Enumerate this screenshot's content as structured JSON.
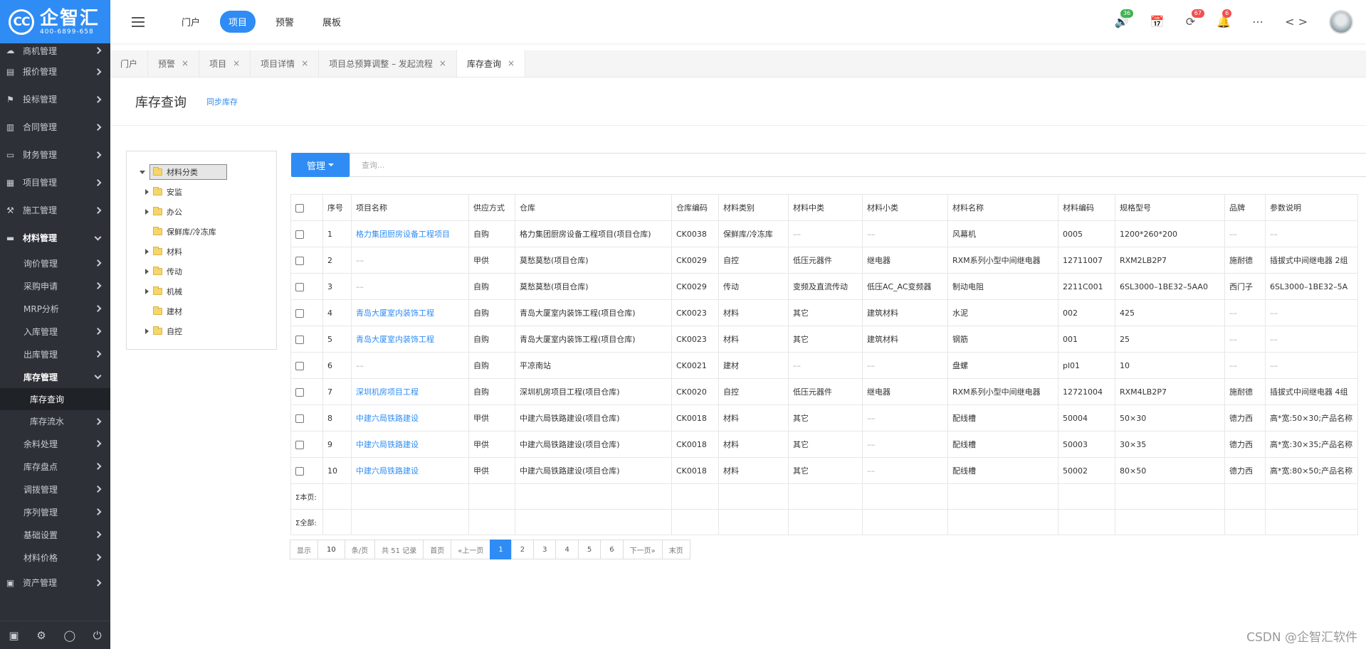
{
  "brand": {
    "name": "企智汇",
    "phone": "400-6899-658",
    "mark": "CC",
    "color": "#2f8cf4"
  },
  "sidebar": {
    "top_items": [
      {
        "label": "商机管理",
        "icon": "cloud-icon"
      },
      {
        "label": "报价管理",
        "icon": "clipboard-icon"
      },
      {
        "label": "投标管理",
        "icon": "flag-icon"
      },
      {
        "label": "合同管理",
        "icon": "book-icon"
      },
      {
        "label": "财务管理",
        "icon": "card-icon"
      },
      {
        "label": "项目管理",
        "icon": "table-icon"
      },
      {
        "label": "施工管理",
        "icon": "hammer-icon"
      },
      {
        "label": "材料管理",
        "icon": "folder-icon"
      }
    ],
    "material_sub": [
      "询价管理",
      "采购申请",
      "MRP分析",
      "入库管理",
      "出库管理",
      "库存管理"
    ],
    "inventory_sub": [
      "库存查询",
      "库存流水"
    ],
    "material_sub_after": [
      "余料处理",
      "库存盘点",
      "调拨管理",
      "序列管理",
      "基础设置",
      "材料价格"
    ],
    "asset": {
      "label": "资产管理",
      "icon": "printer-icon"
    }
  },
  "topnav": {
    "items": [
      "门户",
      "项目",
      "预警",
      "展板"
    ],
    "active": "项目"
  },
  "top_badges": {
    "announcement": "36",
    "refresh": "67",
    "bell": "6"
  },
  "tabs": [
    {
      "label": "门户",
      "closable": false
    },
    {
      "label": "预警",
      "closable": true
    },
    {
      "label": "项目",
      "closable": true
    },
    {
      "label": "项目详情",
      "closable": true
    },
    {
      "label": "项目总预算调整 – 发起流程",
      "closable": true
    },
    {
      "label": "库存查询",
      "closable": true,
      "active": true
    }
  ],
  "page": {
    "title": "库存查询",
    "sync_label": "同步库存"
  },
  "tree": {
    "root": "材料分类",
    "nodes": [
      {
        "label": "安监",
        "has_children": true
      },
      {
        "label": "办公",
        "has_children": true
      },
      {
        "label": "保鲜库/冷冻库",
        "has_children": false
      },
      {
        "label": "材料",
        "has_children": true
      },
      {
        "label": "传动",
        "has_children": true
      },
      {
        "label": "机械",
        "has_children": true
      },
      {
        "label": "建材",
        "has_children": false
      },
      {
        "label": "自控",
        "has_children": true
      }
    ]
  },
  "toolbar": {
    "manage_label": "管理",
    "search_placeholder": "查询..."
  },
  "table": {
    "headers": [
      "序号",
      "项目名称",
      "供应方式",
      "仓库",
      "仓库编码",
      "材料类别",
      "材料中类",
      "材料小类",
      "材料名称",
      "材料编码",
      "规格型号",
      "品牌",
      "参数说明"
    ],
    "rows": [
      [
        "1",
        "格力集团厨房设备工程项目",
        "自购",
        "格力集团厨房设备工程项目(项目仓库)",
        "CK0038",
        "保鲜库/冷冻库",
        "––",
        "––",
        "风幕机",
        "0005",
        "1200*260*200",
        "––",
        "––"
      ],
      [
        "2",
        "––",
        "甲供",
        "莫愁莫愁(项目仓库)",
        "CK0029",
        "自控",
        "低压元器件",
        "继电器",
        "RXM系列小型中间继电器",
        "12711007",
        "RXM2LB2P7",
        "施耐德",
        "插拔式中间继电器 2组"
      ],
      [
        "3",
        "––",
        "自购",
        "莫愁莫愁(项目仓库)",
        "CK0029",
        "传动",
        "变频及直流传动",
        "低压AC_AC变频器",
        "制动电阻",
        "2211C001",
        "6SL3000–1BE32–5AA0",
        "西门子",
        "6SL3000–1BE32–5A"
      ],
      [
        "4",
        "青岛大厦室内装饰工程",
        "自购",
        "青岛大厦室内装饰工程(项目仓库)",
        "CK0023",
        "材料",
        "其它",
        "建筑材料",
        "水泥",
        "002",
        "425",
        "––",
        "––"
      ],
      [
        "5",
        "青岛大厦室内装饰工程",
        "自购",
        "青岛大厦室内装饰工程(项目仓库)",
        "CK0023",
        "材料",
        "其它",
        "建筑材料",
        "钢筋",
        "001",
        "25",
        "––",
        "––"
      ],
      [
        "6",
        "––",
        "自购",
        "平凉南站",
        "CK0021",
        "建材",
        "––",
        "––",
        "盘螺",
        "pl01",
        "10",
        "––",
        "––"
      ],
      [
        "7",
        "深圳机房项目工程",
        "自购",
        "深圳机房项目工程(项目仓库)",
        "CK0020",
        "自控",
        "低压元器件",
        "继电器",
        "RXM系列小型中间继电器",
        "12721004",
        "RXM4LB2P7",
        "施耐德",
        "插拔式中间继电器 4组"
      ],
      [
        "8",
        "中建六局铁路建设",
        "甲供",
        "中建六局铁路建设(项目仓库)",
        "CK0018",
        "材料",
        "其它",
        "––",
        "配线槽",
        "50004",
        "50×30",
        "德力西",
        "高*宽:50×30;产品名称"
      ],
      [
        "9",
        "中建六局铁路建设",
        "甲供",
        "中建六局铁路建设(项目仓库)",
        "CK0018",
        "材料",
        "其它",
        "––",
        "配线槽",
        "50003",
        "30×35",
        "德力西",
        "高*宽:30×35;产品名称"
      ],
      [
        "10",
        "中建六局铁路建设",
        "甲供",
        "中建六局铁路建设(项目仓库)",
        "CK0018",
        "材料",
        "其它",
        "––",
        "配线槽",
        "50002",
        "80×50",
        "德力西",
        "高*宽:80×50;产品名称"
      ]
    ],
    "sum_page_label": "Σ本页:",
    "sum_all_label": "Σ全部:"
  },
  "pager": {
    "show_label": "显示",
    "page_size": "10",
    "per_page_label": "条/页",
    "total_label": "共 51 记录",
    "first": "首页",
    "prev": "«上一页",
    "pages": [
      "1",
      "2",
      "3",
      "4",
      "5",
      "6"
    ],
    "current": "1",
    "next": "下一页»",
    "last": "末页"
  },
  "watermark": "CSDN @企智汇软件"
}
